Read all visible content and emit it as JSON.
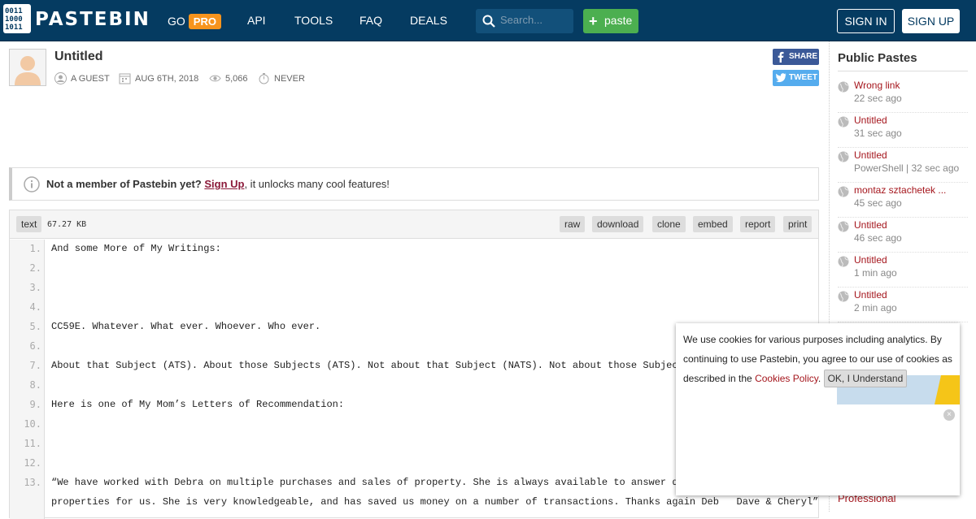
{
  "header": {
    "logo_text": "PASTEBIN",
    "nav": {
      "go": "GO",
      "pro": "PRO",
      "api": "API",
      "tools": "TOOLS",
      "faq": "FAQ",
      "deals": "DEALS"
    },
    "search_placeholder": "Search...",
    "paste_label": "paste",
    "sign_in": "SIGN IN",
    "sign_up": "SIGN UP",
    "colors": {
      "bar": "#053b61",
      "pro": "#f7941d",
      "paste": "#4caf50"
    }
  },
  "paste": {
    "title": "Untitled",
    "author": "A GUEST",
    "date": "AUG 6TH, 2018",
    "views": "5,066",
    "expires": "NEVER",
    "share": "SHARE",
    "tweet": "TWEET"
  },
  "notice": {
    "bold": "Not a member of Pastebin yet?",
    "link": "Sign Up",
    "rest": ", it unlocks many cool features!"
  },
  "code": {
    "syntax": "text",
    "size": "67.27 KB",
    "actions": [
      "raw",
      "download",
      "clone",
      "embed",
      "report",
      "print"
    ],
    "lines": [
      {
        "n": "1.",
        "text": "And some More of My Writings:"
      },
      {
        "n": "2.",
        "text": ""
      },
      {
        "n": "3.",
        "text": ""
      },
      {
        "n": "4.",
        "text": ""
      },
      {
        "n": "5.",
        "text": "CC59E. Whatever. What ever. Whoever. Who ever."
      },
      {
        "n": "6.",
        "text": ""
      },
      {
        "n": "7.",
        "text": "About that Subject (ATS). About those Subjects (ATS). Not about that Subject (NATS). Not about those Subjects"
      },
      {
        "n": "8.",
        "text": ""
      },
      {
        "n": "9.",
        "text": "Here is one of My Mom’s Letters of Recommendation:"
      },
      {
        "n": "10.",
        "text": ""
      },
      {
        "n": "11.",
        "text": ""
      },
      {
        "n": "12.",
        "text": ""
      },
      {
        "n": "13.",
        "text": "“We have worked with Debra on multiple purchases and sales of property. She is always available to answer ques"
      },
      {
        "n": "",
        "text": "properties for us. She is very knowledgeable, and has saved us money on a number of transactions. Thanks again Deb   Dave & Cheryl”"
      }
    ]
  },
  "sidebar": {
    "title": "Public Pastes",
    "items": [
      {
        "name": "Wrong link",
        "time": "22 sec ago"
      },
      {
        "name": "Untitled",
        "time": "31 sec ago"
      },
      {
        "name": "Untitled",
        "time": "PowerShell | 32 sec ago"
      },
      {
        "name": "montaz sztachetek ...",
        "time": "45 sec ago"
      },
      {
        "name": "Untitled",
        "time": "46 sec ago"
      },
      {
        "name": "Untitled",
        "time": "1 min ago"
      },
      {
        "name": "Untitled",
        "time": "2 min ago"
      }
    ],
    "bottom_text": "Professional"
  },
  "cookie": {
    "text": "We use cookies for various purposes including analytics. By continuing to use Pastebin, you agree to our use of cookies as described in the ",
    "link": "Cookies Policy",
    "period": ".",
    "ok": "OK, I Understand"
  }
}
